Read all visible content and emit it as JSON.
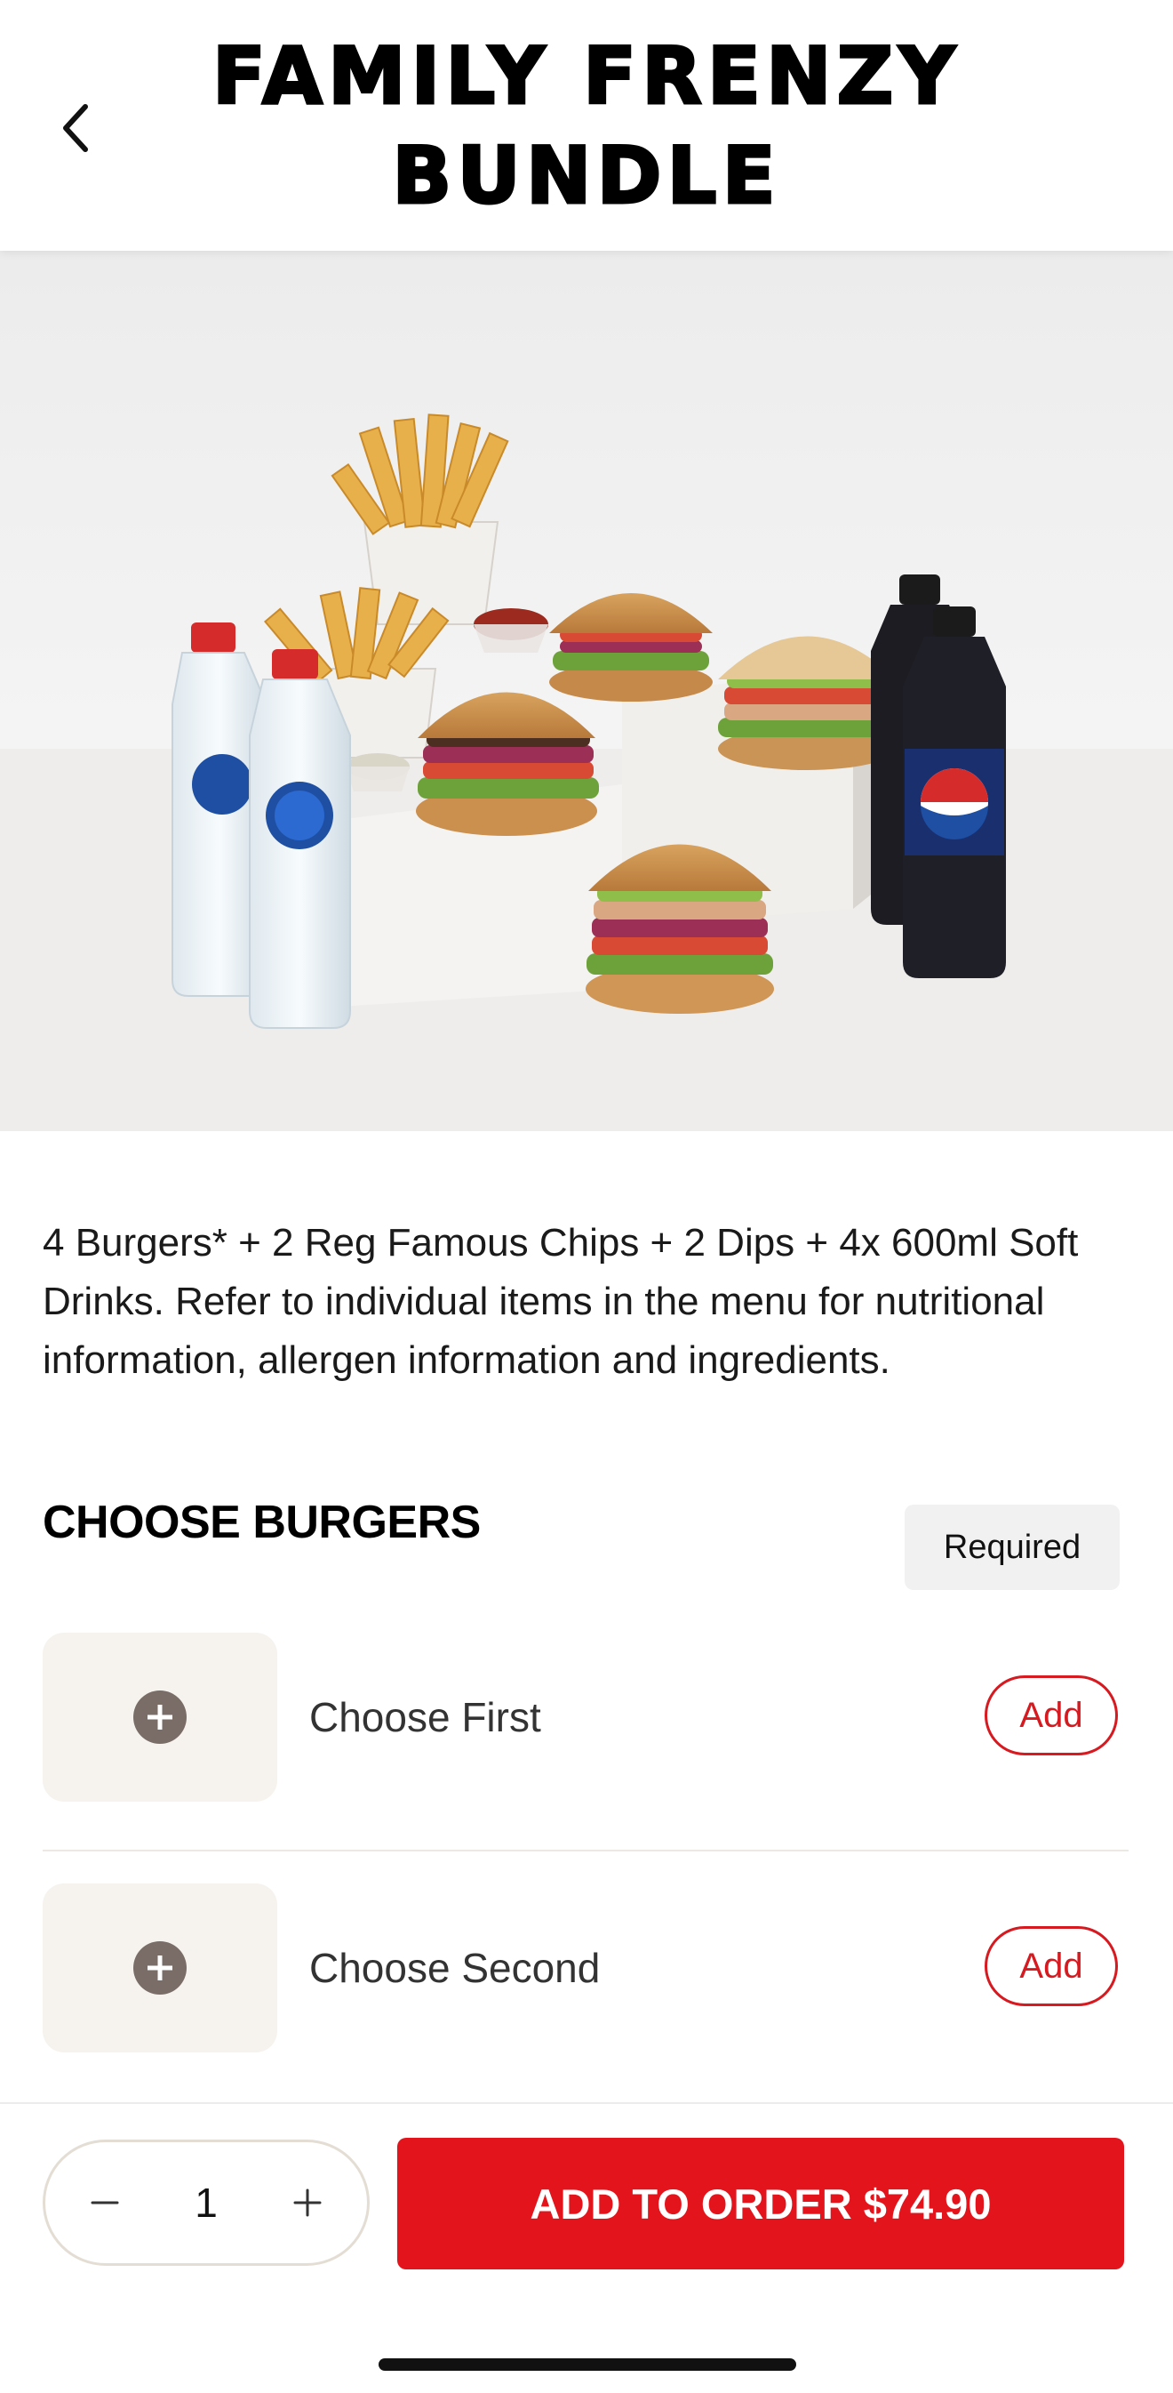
{
  "header": {
    "title": "FAMILY FRENZY BUNDLE",
    "back_icon": "chevron-left-icon"
  },
  "hero": {
    "alt": "Family Frenzy Bundle: four burgers, two chips, two dips, four bottled drinks"
  },
  "product": {
    "description": "4 Burgers* + 2 Reg Famous Chips + 2 Dips + 4x 600ml Soft Drinks. Refer to individual items in the menu for nutritional information, allergen information and ingredients."
  },
  "section": {
    "title": "CHOOSE BURGERS",
    "badge": "Required"
  },
  "options": [
    {
      "label": "Choose First",
      "button": "Add"
    },
    {
      "label": "Choose Second",
      "button": "Add"
    }
  ],
  "footer": {
    "quantity": "1",
    "add_to_order": "ADD TO ORDER $74.90"
  },
  "colors": {
    "accent": "#e3141c",
    "thumb_bg": "#f6f3ee",
    "badge_bg": "#f1f1f1"
  }
}
